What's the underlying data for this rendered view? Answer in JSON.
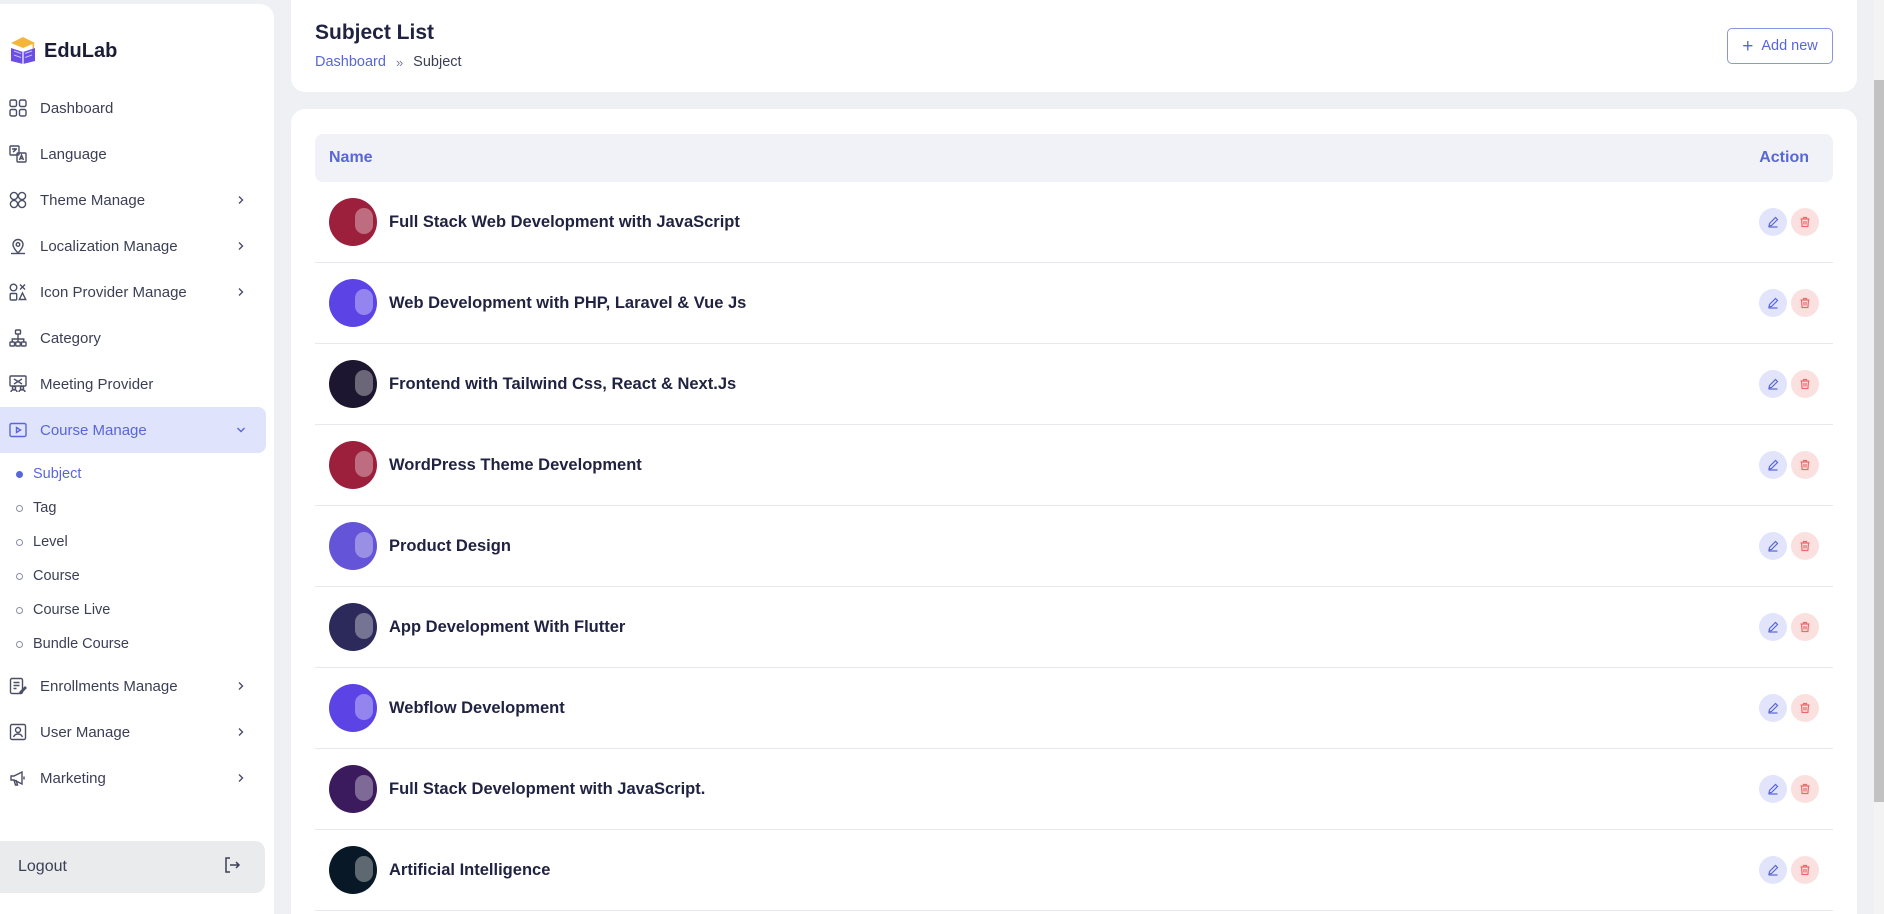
{
  "app": {
    "name": "EduLab"
  },
  "sidebar": {
    "items": [
      {
        "label": "Dashboard",
        "icon": "dashboard-icon",
        "has_chevron": false
      },
      {
        "label": "Language",
        "icon": "language-icon",
        "has_chevron": false
      },
      {
        "label": "Theme Manage",
        "icon": "theme-icon",
        "has_chevron": true
      },
      {
        "label": "Localization Manage",
        "icon": "location-icon",
        "has_chevron": true
      },
      {
        "label": "Icon Provider Manage",
        "icon": "icon-provider-icon",
        "has_chevron": true
      },
      {
        "label": "Category",
        "icon": "category-icon",
        "has_chevron": false
      },
      {
        "label": "Meeting Provider",
        "icon": "meeting-icon",
        "has_chevron": false
      },
      {
        "label": "Course Manage",
        "icon": "course-icon",
        "has_chevron": true,
        "active": true
      }
    ],
    "course_sub": [
      {
        "label": "Subject",
        "active": true
      },
      {
        "label": "Tag"
      },
      {
        "label": "Level"
      },
      {
        "label": "Course"
      },
      {
        "label": "Course Live"
      },
      {
        "label": "Bundle Course"
      }
    ],
    "items_after": [
      {
        "label": "Enrollments Manage",
        "icon": "enrollments-icon",
        "has_chevron": true
      },
      {
        "label": "User Manage",
        "icon": "user-icon",
        "has_chevron": true
      },
      {
        "label": "Marketing",
        "icon": "megaphone-icon",
        "has_chevron": true
      }
    ],
    "logout_label": "Logout"
  },
  "header": {
    "title": "Subject List",
    "breadcrumb": {
      "home": "Dashboard",
      "separator": "»",
      "current": "Subject"
    },
    "add_button": "Add new"
  },
  "table": {
    "columns": {
      "name": "Name",
      "action": "Action"
    },
    "rows": [
      {
        "name": "Full Stack Web Development with JavaScript",
        "thumb_color": "#9c1f3c"
      },
      {
        "name": "Web Development with PHP, Laravel & Vue Js",
        "thumb_color": "#5b43e6"
      },
      {
        "name": "Frontend with Tailwind Css, React & Next.Js",
        "thumb_color": "#1c1630"
      },
      {
        "name": "WordPress Theme Development",
        "thumb_color": "#9c1f3c"
      },
      {
        "name": "Product Design",
        "thumb_color": "#6354d8"
      },
      {
        "name": "App Development With Flutter",
        "thumb_color": "#2c2a5a"
      },
      {
        "name": "Webflow Development",
        "thumb_color": "#5b43e6"
      },
      {
        "name": "Full Stack Development with JavaScript.",
        "thumb_color": "#3b1a5e"
      },
      {
        "name": "Artificial Intelligence",
        "thumb_color": "#081826"
      }
    ]
  },
  "colors": {
    "accent": "#5866d8",
    "active_bg": "#dfe3fb",
    "edit_bg": "#e1e4fa",
    "delete_bg": "#fbe0e0",
    "delete_icon": "#e86a6a"
  }
}
